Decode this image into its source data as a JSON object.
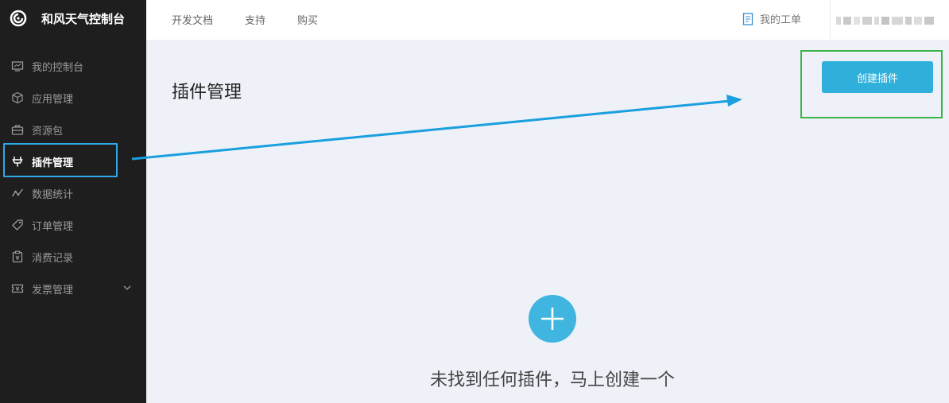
{
  "brand": {
    "title": "和风天气控制台",
    "logo_icon": "swirl-logo"
  },
  "sidebar": {
    "items": [
      {
        "label": "我的控制台",
        "icon": "monitor-icon"
      },
      {
        "label": "应用管理",
        "icon": "cube-icon"
      },
      {
        "label": "资源包",
        "icon": "briefcase-icon"
      },
      {
        "label": "插件管理",
        "icon": "plugin-icon",
        "active": true
      },
      {
        "label": "数据统计",
        "icon": "trend-icon"
      },
      {
        "label": "订单管理",
        "icon": "tag-icon"
      },
      {
        "label": "消费记录",
        "icon": "clipboard-icon"
      },
      {
        "label": "发票管理",
        "icon": "ticket-icon",
        "has_submenu": true
      }
    ]
  },
  "topbar": {
    "nav": [
      "开发文档",
      "支持",
      "购买"
    ],
    "tickets_label": "我的工单"
  },
  "main": {
    "title": "插件管理",
    "create_button": "创建插件",
    "empty_message": "未找到任何插件，马上创建一个"
  },
  "colors": {
    "sidebar_bg": "#1e1e1e",
    "accent": "#2fb0db",
    "annotation_blue": "#1a9fdf",
    "annotation_green": "#3bb54a"
  }
}
